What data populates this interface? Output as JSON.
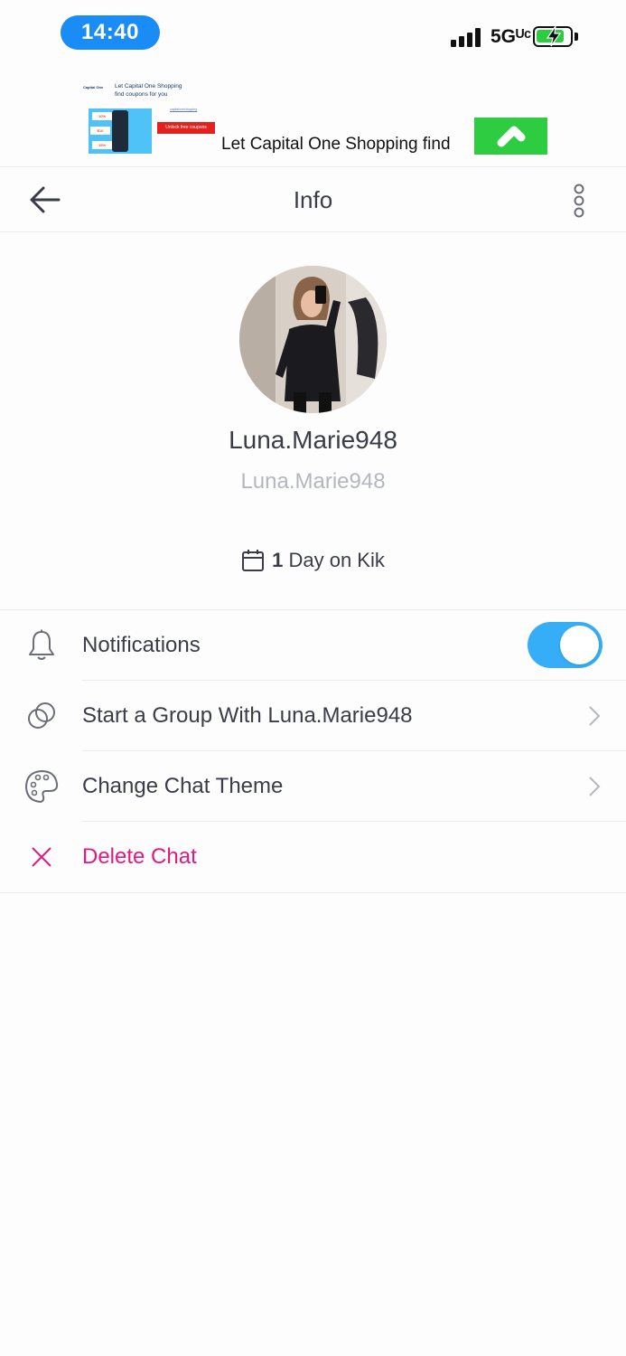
{
  "status_bar": {
    "time": "14:40",
    "network": "5Gᵁᶜ",
    "battery_level": 0.75
  },
  "ad": {
    "small_line1": "Let Capital One Shopping",
    "small_line2": "find coupons for you",
    "button_text": "Unlock free coupons",
    "headline": "Let Capital One Shopping find",
    "cta_color": "#2ecc40"
  },
  "header": {
    "title": "Info",
    "back_icon": "arrow-left-icon",
    "menu_icon": "vertical-dots-icon"
  },
  "profile": {
    "display_name": "Luna.Marie948",
    "username": "Luna.Marie948",
    "days_count": "1",
    "days_suffix": "Day on Kik"
  },
  "settings": {
    "notifications": {
      "label": "Notifications",
      "enabled": true,
      "icon": "bell-icon"
    },
    "start_group": {
      "label": "Start a Group With Luna.Marie948",
      "icon": "group-circles-icon"
    },
    "chat_theme": {
      "label": "Change Chat Theme",
      "icon": "palette-icon"
    },
    "delete_chat": {
      "label": "Delete Chat",
      "icon": "close-icon"
    }
  },
  "colors": {
    "accent": "#36aef7",
    "danger": "#e3197f",
    "time_pill": "#1a8cf5",
    "text_primary": "#3a3d47",
    "text_secondary": "#b4b7bf"
  }
}
